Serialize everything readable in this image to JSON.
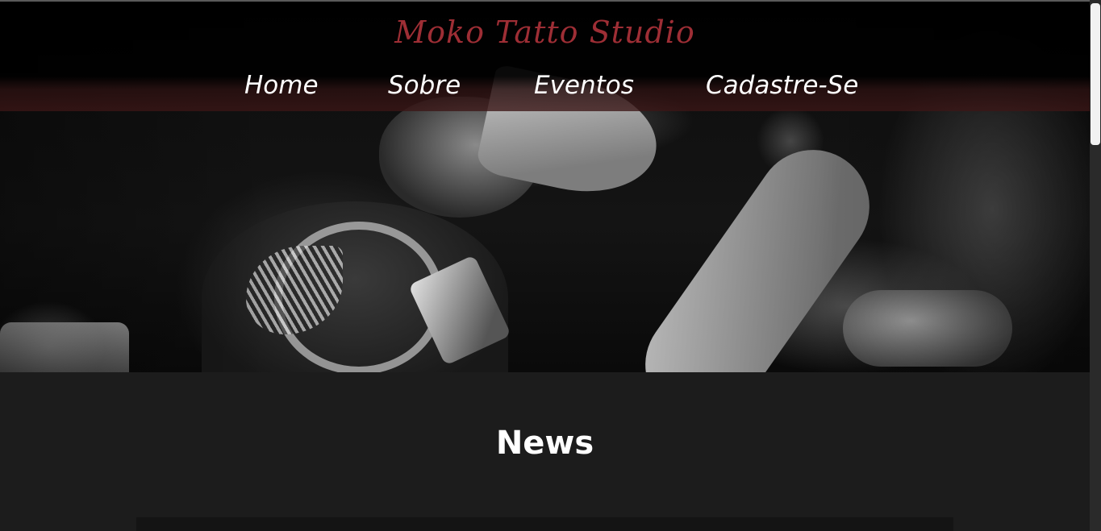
{
  "header": {
    "brand": "Moko Tatto Studio",
    "nav": {
      "home": "Home",
      "sobre": "Sobre",
      "eventos": "Eventos",
      "cadastre": "Cadastre-Se"
    }
  },
  "main": {
    "section_title": "News"
  },
  "colors": {
    "brand": "#9e2e35",
    "background": "#1c1c1c",
    "nav_text": "#ffffff"
  }
}
